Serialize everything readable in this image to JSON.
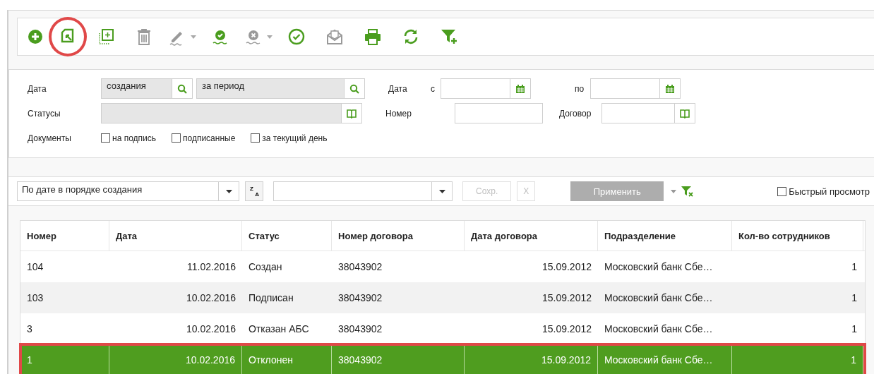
{
  "toolbar": [
    {
      "kind": "add",
      "disabled": false,
      "dropdown": false,
      "highlighted": false
    },
    {
      "kind": "copy",
      "disabled": false,
      "dropdown": false,
      "highlighted": true
    },
    {
      "kind": "new",
      "disabled": false,
      "dropdown": false,
      "highlighted": false
    },
    {
      "kind": "delete",
      "disabled": true,
      "dropdown": false,
      "highlighted": false
    },
    {
      "kind": "edit",
      "disabled": true,
      "dropdown": true,
      "highlighted": false
    },
    {
      "kind": "sign",
      "disabled": false,
      "dropdown": false,
      "highlighted": false
    },
    {
      "kind": "unsign",
      "disabled": true,
      "dropdown": true,
      "highlighted": false
    },
    {
      "kind": "check",
      "disabled": false,
      "dropdown": false,
      "highlighted": false
    },
    {
      "kind": "mail",
      "disabled": true,
      "dropdown": false,
      "highlighted": false
    },
    {
      "kind": "print",
      "disabled": false,
      "dropdown": false,
      "highlighted": false
    },
    {
      "kind": "refresh",
      "disabled": false,
      "dropdown": false,
      "highlighted": false
    },
    {
      "kind": "filter",
      "disabled": false,
      "dropdown": false,
      "highlighted": false
    }
  ],
  "filters": {
    "date_label": "Дата",
    "date_type": "создания",
    "date_range": "за период",
    "date_from_label": "Дата",
    "from_label": "с",
    "to_label": "по",
    "statuses_label": "Статусы",
    "number_label": "Номер",
    "contract_label": "Договор",
    "documents_label": "Документы",
    "documents": [
      {
        "label": "на подпись",
        "checked": false
      },
      {
        "label": "подписанные",
        "checked": false
      },
      {
        "label": "за текущий день",
        "checked": false
      }
    ]
  },
  "sortbar": {
    "sort": "По дате в порядке создания",
    "direction": {
      "top": "Z",
      "bottom": "A"
    },
    "save": "Сохр.",
    "clear": "X",
    "apply": "Применить",
    "quick_view": {
      "label": "Быстрый просмотр",
      "checked": false
    }
  },
  "table": {
    "columns": [
      "Номер",
      "Дата",
      "Статус",
      "Номер договора",
      "Дата договора",
      "Подразделение",
      "Кол-во сотрудников"
    ],
    "rows": [
      {
        "cells": [
          "104",
          "11.02.2016",
          "Создан",
          "38043902",
          "15.09.2012",
          "Московский банк Сбе…",
          "1"
        ],
        "selected": false,
        "highlighted": false
      },
      {
        "cells": [
          "103",
          "10.02.2016",
          "Подписан",
          "38043902",
          "15.09.2012",
          "Московский банк Сбе…",
          "1"
        ],
        "selected": false,
        "highlighted": false
      },
      {
        "cells": [
          "3",
          "10.02.2016",
          "Отказан АБС",
          "38043902",
          "15.09.2012",
          "Московский банк Сбе…",
          "1"
        ],
        "selected": false,
        "highlighted": false
      },
      {
        "cells": [
          "1",
          "10.02.2016",
          "Отклонен",
          "38043902",
          "15.09.2012",
          "Московский банк Сбе…",
          "1"
        ],
        "selected": true,
        "highlighted": true
      }
    ]
  }
}
